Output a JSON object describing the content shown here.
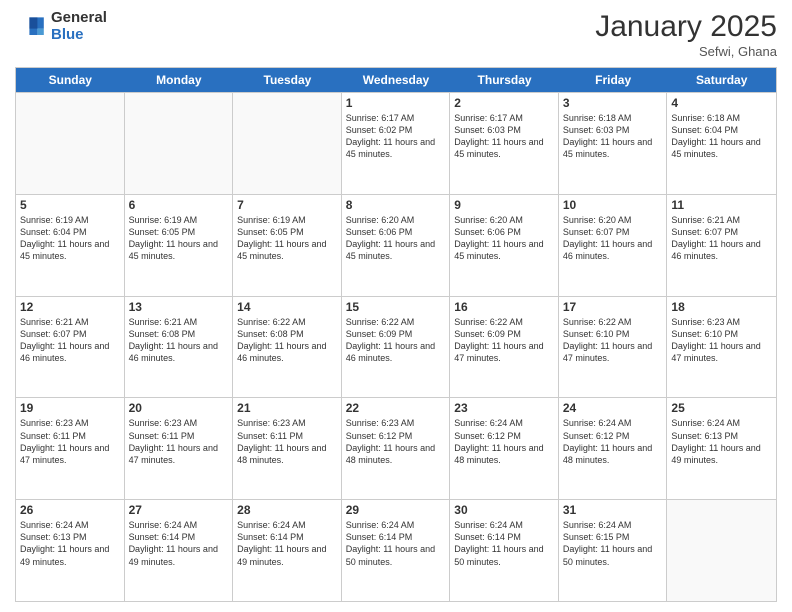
{
  "header": {
    "logo_general": "General",
    "logo_blue": "Blue",
    "month": "January 2025",
    "location": "Sefwi, Ghana"
  },
  "days": [
    "Sunday",
    "Monday",
    "Tuesday",
    "Wednesday",
    "Thursday",
    "Friday",
    "Saturday"
  ],
  "rows": [
    [
      {
        "num": "",
        "sunrise": "",
        "sunset": "",
        "daylight": "",
        "empty": true
      },
      {
        "num": "",
        "sunrise": "",
        "sunset": "",
        "daylight": "",
        "empty": true
      },
      {
        "num": "",
        "sunrise": "",
        "sunset": "",
        "daylight": "",
        "empty": true
      },
      {
        "num": "1",
        "sunrise": "Sunrise: 6:17 AM",
        "sunset": "Sunset: 6:02 PM",
        "daylight": "Daylight: 11 hours and 45 minutes."
      },
      {
        "num": "2",
        "sunrise": "Sunrise: 6:17 AM",
        "sunset": "Sunset: 6:03 PM",
        "daylight": "Daylight: 11 hours and 45 minutes."
      },
      {
        "num": "3",
        "sunrise": "Sunrise: 6:18 AM",
        "sunset": "Sunset: 6:03 PM",
        "daylight": "Daylight: 11 hours and 45 minutes."
      },
      {
        "num": "4",
        "sunrise": "Sunrise: 6:18 AM",
        "sunset": "Sunset: 6:04 PM",
        "daylight": "Daylight: 11 hours and 45 minutes."
      }
    ],
    [
      {
        "num": "5",
        "sunrise": "Sunrise: 6:19 AM",
        "sunset": "Sunset: 6:04 PM",
        "daylight": "Daylight: 11 hours and 45 minutes."
      },
      {
        "num": "6",
        "sunrise": "Sunrise: 6:19 AM",
        "sunset": "Sunset: 6:05 PM",
        "daylight": "Daylight: 11 hours and 45 minutes."
      },
      {
        "num": "7",
        "sunrise": "Sunrise: 6:19 AM",
        "sunset": "Sunset: 6:05 PM",
        "daylight": "Daylight: 11 hours and 45 minutes."
      },
      {
        "num": "8",
        "sunrise": "Sunrise: 6:20 AM",
        "sunset": "Sunset: 6:06 PM",
        "daylight": "Daylight: 11 hours and 45 minutes."
      },
      {
        "num": "9",
        "sunrise": "Sunrise: 6:20 AM",
        "sunset": "Sunset: 6:06 PM",
        "daylight": "Daylight: 11 hours and 45 minutes."
      },
      {
        "num": "10",
        "sunrise": "Sunrise: 6:20 AM",
        "sunset": "Sunset: 6:07 PM",
        "daylight": "Daylight: 11 hours and 46 minutes."
      },
      {
        "num": "11",
        "sunrise": "Sunrise: 6:21 AM",
        "sunset": "Sunset: 6:07 PM",
        "daylight": "Daylight: 11 hours and 46 minutes."
      }
    ],
    [
      {
        "num": "12",
        "sunrise": "Sunrise: 6:21 AM",
        "sunset": "Sunset: 6:07 PM",
        "daylight": "Daylight: 11 hours and 46 minutes."
      },
      {
        "num": "13",
        "sunrise": "Sunrise: 6:21 AM",
        "sunset": "Sunset: 6:08 PM",
        "daylight": "Daylight: 11 hours and 46 minutes."
      },
      {
        "num": "14",
        "sunrise": "Sunrise: 6:22 AM",
        "sunset": "Sunset: 6:08 PM",
        "daylight": "Daylight: 11 hours and 46 minutes."
      },
      {
        "num": "15",
        "sunrise": "Sunrise: 6:22 AM",
        "sunset": "Sunset: 6:09 PM",
        "daylight": "Daylight: 11 hours and 46 minutes."
      },
      {
        "num": "16",
        "sunrise": "Sunrise: 6:22 AM",
        "sunset": "Sunset: 6:09 PM",
        "daylight": "Daylight: 11 hours and 47 minutes."
      },
      {
        "num": "17",
        "sunrise": "Sunrise: 6:22 AM",
        "sunset": "Sunset: 6:10 PM",
        "daylight": "Daylight: 11 hours and 47 minutes."
      },
      {
        "num": "18",
        "sunrise": "Sunrise: 6:23 AM",
        "sunset": "Sunset: 6:10 PM",
        "daylight": "Daylight: 11 hours and 47 minutes."
      }
    ],
    [
      {
        "num": "19",
        "sunrise": "Sunrise: 6:23 AM",
        "sunset": "Sunset: 6:11 PM",
        "daylight": "Daylight: 11 hours and 47 minutes."
      },
      {
        "num": "20",
        "sunrise": "Sunrise: 6:23 AM",
        "sunset": "Sunset: 6:11 PM",
        "daylight": "Daylight: 11 hours and 47 minutes."
      },
      {
        "num": "21",
        "sunrise": "Sunrise: 6:23 AM",
        "sunset": "Sunset: 6:11 PM",
        "daylight": "Daylight: 11 hours and 48 minutes."
      },
      {
        "num": "22",
        "sunrise": "Sunrise: 6:23 AM",
        "sunset": "Sunset: 6:12 PM",
        "daylight": "Daylight: 11 hours and 48 minutes."
      },
      {
        "num": "23",
        "sunrise": "Sunrise: 6:24 AM",
        "sunset": "Sunset: 6:12 PM",
        "daylight": "Daylight: 11 hours and 48 minutes."
      },
      {
        "num": "24",
        "sunrise": "Sunrise: 6:24 AM",
        "sunset": "Sunset: 6:12 PM",
        "daylight": "Daylight: 11 hours and 48 minutes."
      },
      {
        "num": "25",
        "sunrise": "Sunrise: 6:24 AM",
        "sunset": "Sunset: 6:13 PM",
        "daylight": "Daylight: 11 hours and 49 minutes."
      }
    ],
    [
      {
        "num": "26",
        "sunrise": "Sunrise: 6:24 AM",
        "sunset": "Sunset: 6:13 PM",
        "daylight": "Daylight: 11 hours and 49 minutes."
      },
      {
        "num": "27",
        "sunrise": "Sunrise: 6:24 AM",
        "sunset": "Sunset: 6:14 PM",
        "daylight": "Daylight: 11 hours and 49 minutes."
      },
      {
        "num": "28",
        "sunrise": "Sunrise: 6:24 AM",
        "sunset": "Sunset: 6:14 PM",
        "daylight": "Daylight: 11 hours and 49 minutes."
      },
      {
        "num": "29",
        "sunrise": "Sunrise: 6:24 AM",
        "sunset": "Sunset: 6:14 PM",
        "daylight": "Daylight: 11 hours and 50 minutes."
      },
      {
        "num": "30",
        "sunrise": "Sunrise: 6:24 AM",
        "sunset": "Sunset: 6:14 PM",
        "daylight": "Daylight: 11 hours and 50 minutes."
      },
      {
        "num": "31",
        "sunrise": "Sunrise: 6:24 AM",
        "sunset": "Sunset: 6:15 PM",
        "daylight": "Daylight: 11 hours and 50 minutes."
      },
      {
        "num": "",
        "sunrise": "",
        "sunset": "",
        "daylight": "",
        "empty": true
      }
    ]
  ]
}
